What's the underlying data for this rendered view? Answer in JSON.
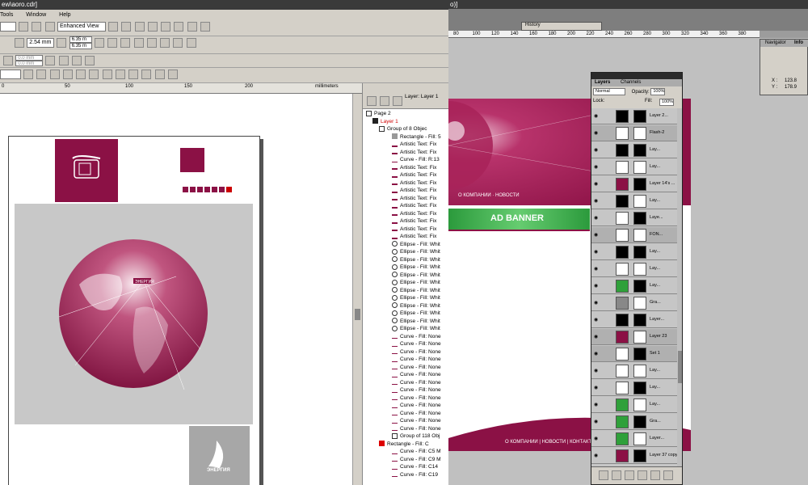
{
  "corel": {
    "title": "ew\\aoro.cdr]",
    "menu": [
      "Tools",
      "Window",
      "Help"
    ],
    "view_mode": "Enhanced View",
    "nudge": "2.54 mm",
    "dup_x": "6.35 m",
    "dup_y": "6.35 m",
    "pos_x": "0.0 mm",
    "pos_y": "0.0 mm",
    "ruler_labels": [
      "0",
      "50",
      "100",
      "150",
      "200"
    ],
    "ruler_unit": "millimeters"
  },
  "artwork": {
    "globe_label": "ЭНЕРГИЯ",
    "logo_label": "ЭНЕРГИЯ"
  },
  "object_manager": {
    "page": "Page 2",
    "layer_tab": "Layer: Layer 1",
    "layer": "Layer 1",
    "items": [
      "Group of 8 Objec",
      "Rectangle - Fill: 5",
      "Artistic Text: Fix",
      "Artistic Text: Fix",
      "Curve - Fill: R:13",
      "Artistic Text: Fix",
      "Artistic Text: Fix",
      "Artistic Text: Fix",
      "Artistic Text: Fix",
      "Artistic Text: Fix",
      "Artistic Text: Fix",
      "Artistic Text: Fix",
      "Artistic Text: Fix",
      "Artistic Text: Fix",
      "Artistic Text: Fix",
      "Ellipse - Fill: Whit",
      "Ellipse - Fill: Whit",
      "Ellipse - Fill: Whit",
      "Ellipse - Fill: Whit",
      "Ellipse - Fill: Whit",
      "Ellipse - Fill: Whit",
      "Ellipse - Fill: Whit",
      "Ellipse - Fill: Whit",
      "Ellipse - Fill: Whit",
      "Ellipse - Fill: Whit",
      "Ellipse - Fill: Whit",
      "Ellipse - Fill: Whit",
      "Curve - Fill: None",
      "Curve - Fill: None",
      "Curve - Fill: None",
      "Curve - Fill: None",
      "Curve - Fill: None",
      "Curve - Fill: None",
      "Curve - Fill: None",
      "Curve - Fill: None",
      "Curve - Fill: None",
      "Curve - Fill: None",
      "Curve - Fill: None",
      "Curve - Fill: None",
      "Curve - Fill: None",
      "Group of 118 Obj",
      "Rectangle - Fill: C",
      "Curve - Fill: C5 M",
      "Curve - Fill: C9 M",
      "Curve - Fill: C14",
      "Curve - Fill: C19"
    ]
  },
  "photoshop": {
    "title": "o)]",
    "history_tab": "History",
    "navigator_tab": "Navigator",
    "info_tab": "Info",
    "info_x": "123.8",
    "info_y": "178.9",
    "ruler_labels": [
      "80",
      "100",
      "120",
      "140",
      "160",
      "180",
      "200",
      "220",
      "240",
      "260",
      "280",
      "300",
      "320",
      "340",
      "360",
      "380"
    ],
    "banner_nav_top": "О КОМПАНИИ · НОВОСТИ",
    "banner_title": "AD BANNER",
    "banner_nav_bottom": "О КОМПАНИИ | НОВОСТИ | КОНТАКТЫ | ЛИЦ"
  },
  "layers_panel": {
    "tab_layers": "Layers",
    "tab_channels": "Channels",
    "blend_mode": "Normal",
    "opacity_label": "Opacity:",
    "opacity": "100%",
    "lock_label": "Lock:",
    "fill_label": "Fill:",
    "fill": "100%",
    "rows": [
      "Layer 2...",
      "Flash-2",
      "Lay...",
      "Lay...",
      "Layer 14's ...",
      "Lay...",
      "Laye...",
      "FON...",
      "Lay...",
      "Lay...",
      "Lay...",
      "Gra...",
      "Layer...",
      "Layer 23",
      "Set 1",
      "Lay...",
      "Lay...",
      "Lay...",
      "Gra...",
      "Layer...",
      "Layer 37 copy..."
    ]
  },
  "colors": {
    "brand": "#8b1145",
    "banner_green": "#3aa84a",
    "canvas_gray": "#c8c8c8"
  }
}
